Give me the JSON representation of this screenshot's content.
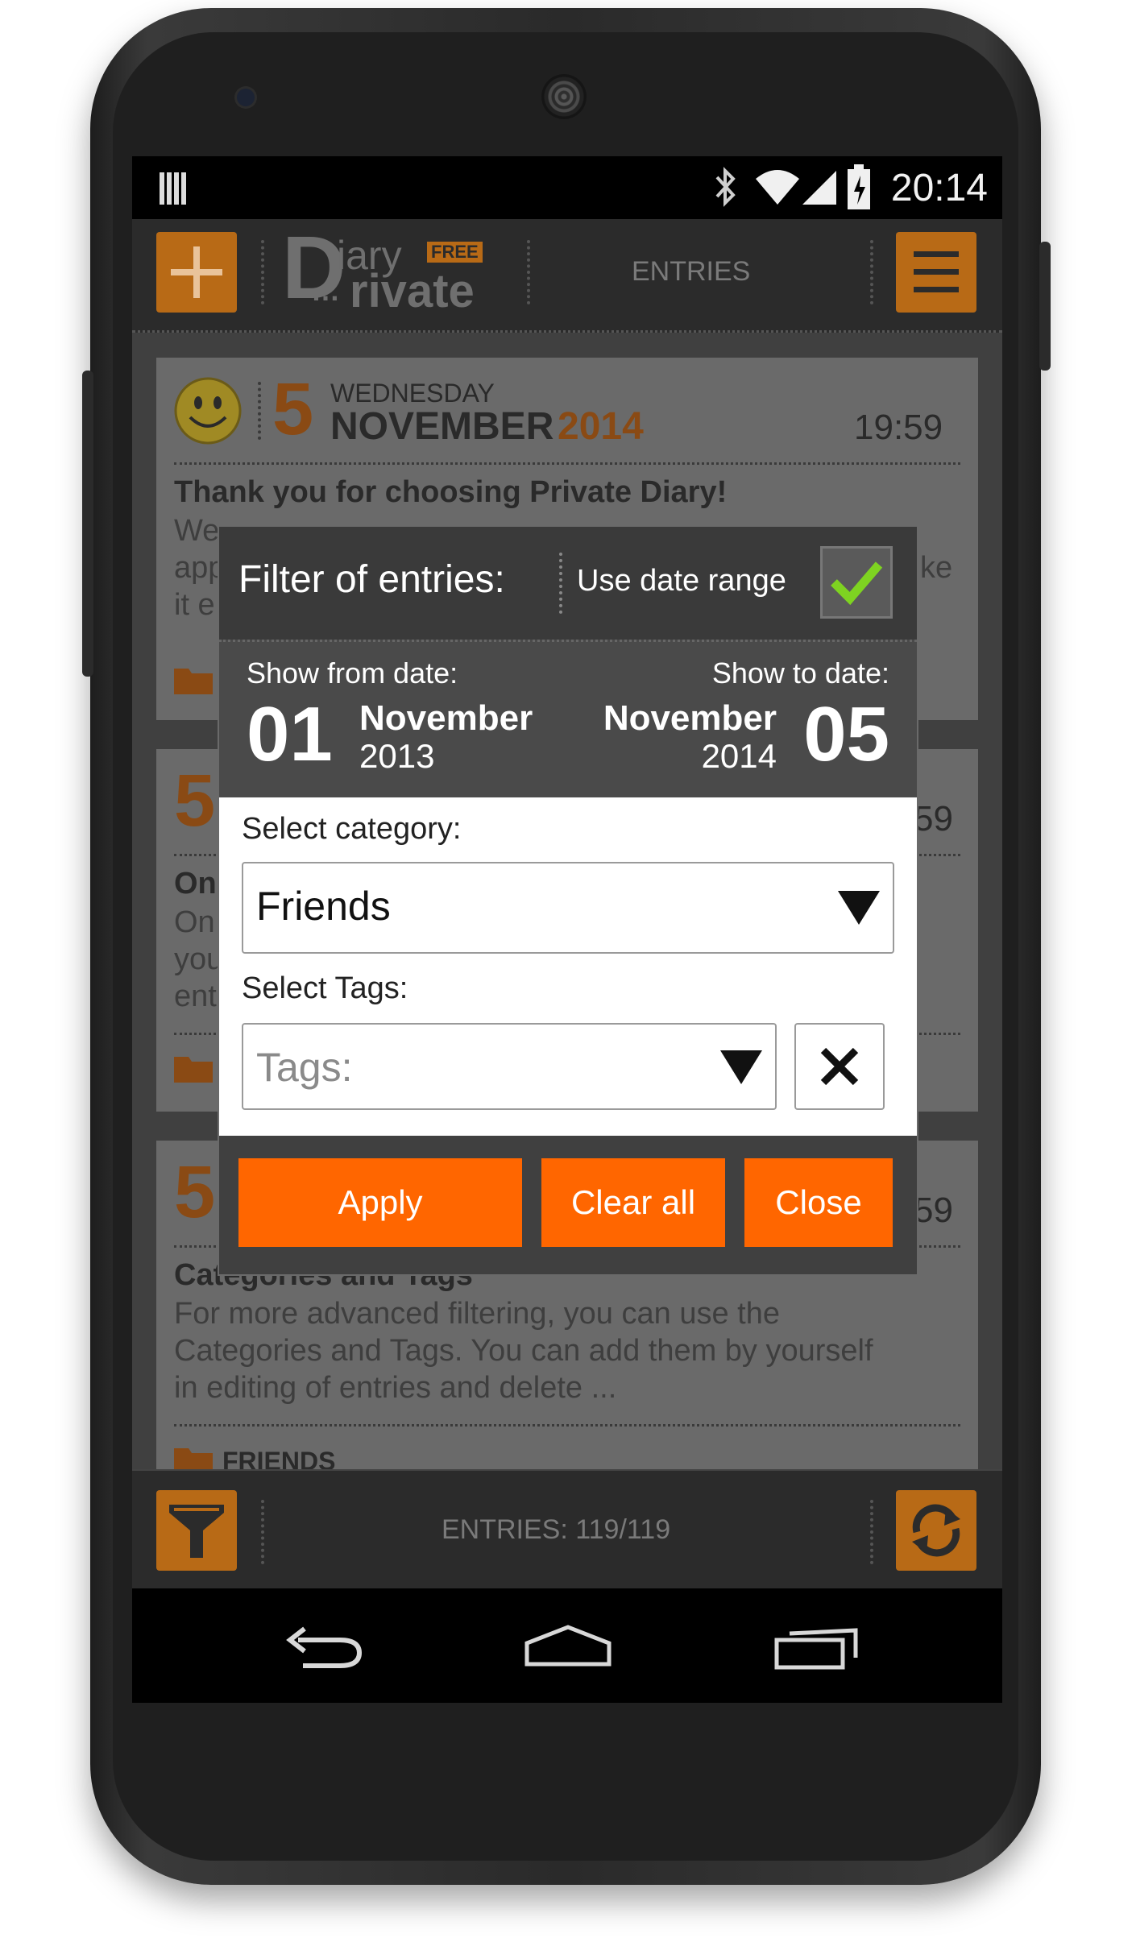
{
  "status_bar": {
    "time": "20:14"
  },
  "app_header": {
    "logo_top": "iary",
    "logo_badge": "FREE",
    "logo_bottom": "rivate",
    "title": "ENTRIES"
  },
  "entries": [
    {
      "day": "5",
      "weekday": "WEDNESDAY",
      "month": "NOVEMBER",
      "year": "2014",
      "time": "19:59",
      "title": "Thank you for choosing Private Diary!",
      "body_visible": [
        "We",
        "app",
        "it e"
      ],
      "body_right": "ke"
    },
    {
      "day": "5",
      "time": "59",
      "title": "On",
      "body_visible": [
        "On",
        "you",
        "ent"
      ]
    },
    {
      "day": "5",
      "time": "59",
      "title": "Categories and Tags",
      "body": "For more advanced filtering, you can use the Categories and Tags. You can add them by yourself in editing of entries and delete ...",
      "body_lines": [
        "For more advanced filtering, you can use the",
        "Categories and Tags. You can add them by yourself",
        "in editing of entries and delete ..."
      ],
      "category": "FRIENDS"
    }
  ],
  "filter_dialog": {
    "title": "Filter of entries:",
    "date_range_label": "Use date range",
    "date_range_checked": true,
    "from_label": "Show from date:",
    "to_label": "Show to date:",
    "from_day": "01",
    "from_month": "November",
    "from_year": "2013",
    "to_day": "05",
    "to_month": "November",
    "to_year": "2014",
    "category_label": "Select category:",
    "category_value": "Friends",
    "tags_label": "Select Tags:",
    "tags_placeholder": "Tags:",
    "apply": "Apply",
    "clear_all": "Clear all",
    "close": "Close"
  },
  "bottom_bar": {
    "entries_count": "ENTRIES: 119/119"
  },
  "colors": {
    "accent": "#ff6600",
    "accent_dim": "#b86a16",
    "check": "#7ed321"
  }
}
